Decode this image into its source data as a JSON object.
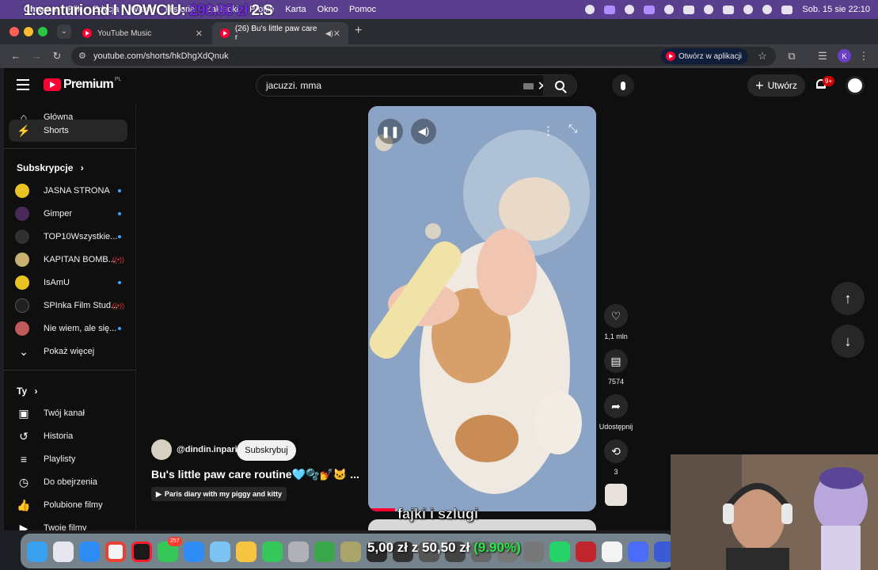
{
  "menubar": {
    "app": "Chrome",
    "items": [
      "Plik",
      "Edycja",
      "Widok",
      "Historia",
      "Zakładki",
      "Profile",
      "Karta",
      "Okno",
      "Pomoc"
    ],
    "clock": "Sob. 15 sie  22:10"
  },
  "overlay": {
    "prefix": "1.centuriond I NOWCIU: ",
    "amount": "290.80 zł",
    "suffix": "  2.S"
  },
  "tabs": [
    {
      "label": "YouTube Music"
    },
    {
      "label": "(26) Bu's little paw care r"
    }
  ],
  "toolbar": {
    "url": "youtube.com/shorts/hkDhgXdQnuk",
    "open_in_app": "Otwórz w aplikacji",
    "profile_initial": "K"
  },
  "yt": {
    "logo_text": "Premium",
    "region": "PL",
    "search_value": "jacuzzi. mma",
    "create_label": "Utwórz",
    "notifications": "9+"
  },
  "sidebar": {
    "home": "Główna",
    "shorts": "Shorts",
    "subs_heading": "Subskrypcje",
    "channels": [
      {
        "name": "JASNA STRONA",
        "color": "#e8c321"
      },
      {
        "name": "Gimper",
        "color": "#4a2a5a"
      },
      {
        "name": "TOP10Wszystkie...",
        "color": "#303030"
      },
      {
        "name": "KAPITAN BOMB...",
        "color": "#c8b070"
      },
      {
        "name": "IsAmU",
        "color": "#e8c321"
      },
      {
        "name": "SPInka Film Stud...",
        "color": "#202020"
      },
      {
        "name": "Nie wiem, ale się...",
        "color": "#c05a5a"
      }
    ],
    "show_more": "Pokaż więcej",
    "you_heading": "Ty",
    "you_items": [
      "Twój kanał",
      "Historia",
      "Playlisty",
      "Do obejrzenia",
      "Polubione filmy",
      "Twoje filmy"
    ]
  },
  "short": {
    "channel": "@dindin.inparis",
    "subscribe": "Subskrybuj",
    "title": "Bu's little paw care routine🩵🫧💅🐱 ...",
    "playlist": "Paris diary with my piggy and kitty",
    "caption": "fajki i szlugi",
    "likes": "1,1 mln",
    "comments": "7574",
    "share": "Udostępnij",
    "remix": "3"
  },
  "ticker": {
    "left": "5,00 zł",
    "mid": " z ",
    "right": "50,50 zł",
    "pct": " (9.90%)"
  },
  "dock_badge": "257"
}
